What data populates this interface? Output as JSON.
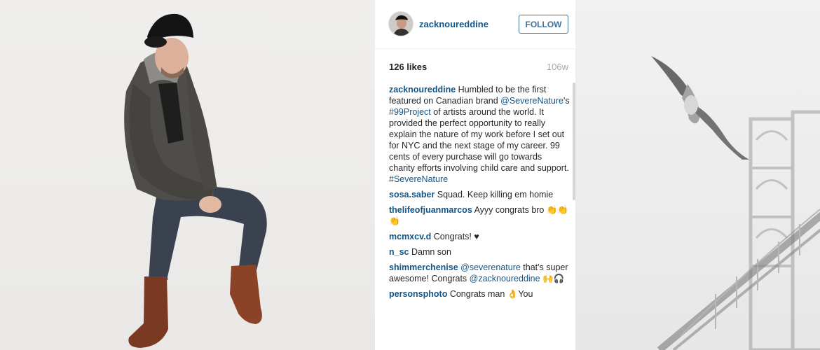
{
  "post": {
    "author": "zacknoureddine",
    "follow_label": "FOLLOW",
    "likes": "126 likes",
    "age": "106w"
  },
  "comments": [
    {
      "user": "zacknoureddine",
      "parts": [
        {
          "t": " Humbled to be the first featured on Canadian brand "
        },
        {
          "t": "@SevereNature",
          "link": true
        },
        {
          "t": "'s "
        },
        {
          "t": "#99Project",
          "link": true
        },
        {
          "t": " of artists around the world. It provided the perfect opportunity to really explain the nature of my work before I set out for NYC and the next stage of my career. 99 cents of every purchase will go towards charity efforts involving child care and support. "
        },
        {
          "t": "#SevereNature",
          "link": true
        }
      ]
    },
    {
      "user": "sosa.saber",
      "parts": [
        {
          "t": " Squad. Keep killing em homie"
        }
      ]
    },
    {
      "user": "thelifeofjuanmarcos",
      "parts": [
        {
          "t": " Ayyy congrats bro 👏👏👏"
        }
      ]
    },
    {
      "user": "mcmxcv.d",
      "parts": [
        {
          "t": " Congrats! ♥"
        }
      ]
    },
    {
      "user": "n_sc",
      "parts": [
        {
          "t": " Damn son"
        }
      ]
    },
    {
      "user": "shimmerchenise",
      "parts": [
        {
          "t": " "
        },
        {
          "t": "@severenature",
          "link": true
        },
        {
          "t": " that's super awesome! Congrats "
        },
        {
          "t": "@zacknoureddine",
          "link": true
        },
        {
          "t": " 🙌🎧"
        }
      ]
    },
    {
      "user": "personsphoto",
      "parts": [
        {
          "t": " Congrats man 👌You"
        }
      ]
    }
  ],
  "colors": {
    "link": "#125688",
    "follow": "#3f729b",
    "muted": "#a5a7aa"
  }
}
